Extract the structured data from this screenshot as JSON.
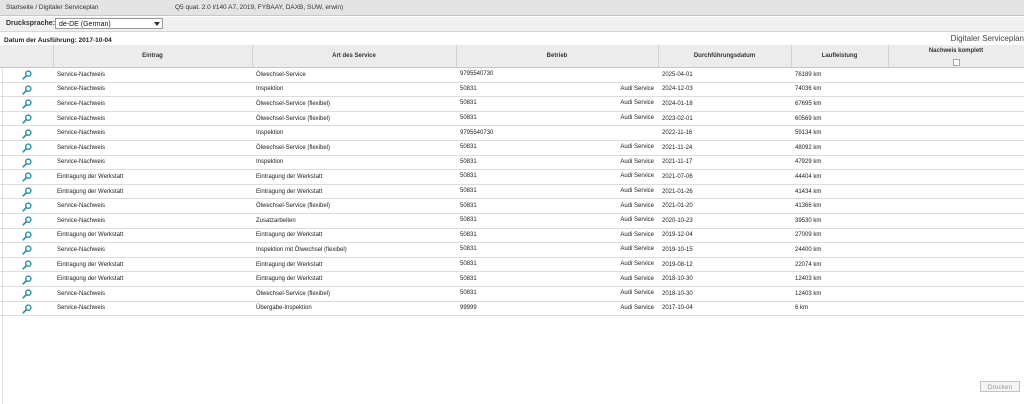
{
  "header": {
    "breadcrumb": "Startseite / Digitaler Serviceplan",
    "vehicle": "Q5 quat. 2.0 l/140 A7, 2019, FYBAAY, DAXB, SUW, erwin)",
    "app_title": "Digitaler Serviceplan"
  },
  "language": {
    "label": "Drucksprache:",
    "selected": "de-DE (German)"
  },
  "print_date": "Datum der Ausführung: 2017-10-04",
  "table": {
    "headers": {
      "entry": "Eintrag",
      "service": "Art des Service",
      "workshop": "Betrieb",
      "date": "Durchführungsdatum",
      "mileage": "Laufleistung",
      "verified": "Nachweis komplett"
    },
    "rows": [
      {
        "entry": "Service-Nachweis",
        "service": "Ölwechsel-Service",
        "code": "9795540730",
        "name": "",
        "date": "2025-04-01",
        "km": "76189 km"
      },
      {
        "entry": "Service-Nachweis",
        "service": "Inspektion",
        "code": "50831",
        "name": "Audi Service",
        "date": "2024-12-03",
        "km": "74036 km"
      },
      {
        "entry": "Service-Nachweis",
        "service": "Ölwechsel-Service (flexibel)",
        "code": "50831",
        "name": "Audi Service",
        "date": "2024-01-18",
        "km": "67695 km"
      },
      {
        "entry": "Service-Nachweis",
        "service": "Ölwechsel-Service (flexibel)",
        "code": "50831",
        "name": "Audi Service",
        "date": "2023-02-01",
        "km": "60569 km"
      },
      {
        "entry": "Service-Nachweis",
        "service": "Inspektion",
        "code": "9795540730",
        "name": "",
        "date": "2022-11-16",
        "km": "59134 km"
      },
      {
        "entry": "Service-Nachweis",
        "service": "Ölwechsel-Service (flexibel)",
        "code": "50831",
        "name": "Audi Service",
        "date": "2021-11-24",
        "km": "48092 km"
      },
      {
        "entry": "Service-Nachweis",
        "service": "Inspektion",
        "code": "50831",
        "name": "Audi Service",
        "date": "2021-11-17",
        "km": "47929 km"
      },
      {
        "entry": "Eintragung der Werkstatt",
        "service": "Eintragung der Werkstatt",
        "code": "50831",
        "name": "Audi Service",
        "date": "2021-07-06",
        "km": "44404 km"
      },
      {
        "entry": "Eintragung der Werkstatt",
        "service": "Eintragung der Werkstatt",
        "code": "50831",
        "name": "Audi Service",
        "date": "2021-01-26",
        "km": "41434 km"
      },
      {
        "entry": "Service-Nachweis",
        "service": "Ölwechsel-Service (flexibel)",
        "code": "50831",
        "name": "Audi Service",
        "date": "2021-01-20",
        "km": "41366 km"
      },
      {
        "entry": "Service-Nachweis",
        "service": "Zusatzarbeiten",
        "code": "50831",
        "name": "Audi Service",
        "date": "2020-10-23",
        "km": "39530 km"
      },
      {
        "entry": "Eintragung der Werkstatt",
        "service": "Eintragung der Werkstatt",
        "code": "50831",
        "name": "Audi Service",
        "date": "2019-12-04",
        "km": "27009 km"
      },
      {
        "entry": "Service-Nachweis",
        "service": "Inspektion mit Ölwechsel (flexibel)",
        "code": "50831",
        "name": "Audi Service",
        "date": "2019-10-15",
        "km": "24400 km"
      },
      {
        "entry": "Eintragung der Werkstatt",
        "service": "Eintragung der Werkstatt",
        "code": "50831",
        "name": "Audi Service",
        "date": "2019-08-12",
        "km": "22074 km"
      },
      {
        "entry": "Eintragung der Werkstatt",
        "service": "Eintragung der Werkstatt",
        "code": "50831",
        "name": "Audi Service",
        "date": "2018-10-30",
        "km": "12403 km"
      },
      {
        "entry": "Service-Nachweis",
        "service": "Ölwechsel-Service (flexibel)",
        "code": "50831",
        "name": "Audi Service",
        "date": "2018-10-30",
        "km": "12403 km"
      },
      {
        "entry": "Service-Nachweis",
        "service": "Übergabe-Inspektion",
        "code": "99999",
        "name": "Audi Service",
        "date": "2017-10-04",
        "km": "6 km"
      }
    ]
  },
  "print_button": "Drucken",
  "icons": {
    "row_icon": "wrench-key-icon",
    "accent": "#2a8fa0"
  }
}
